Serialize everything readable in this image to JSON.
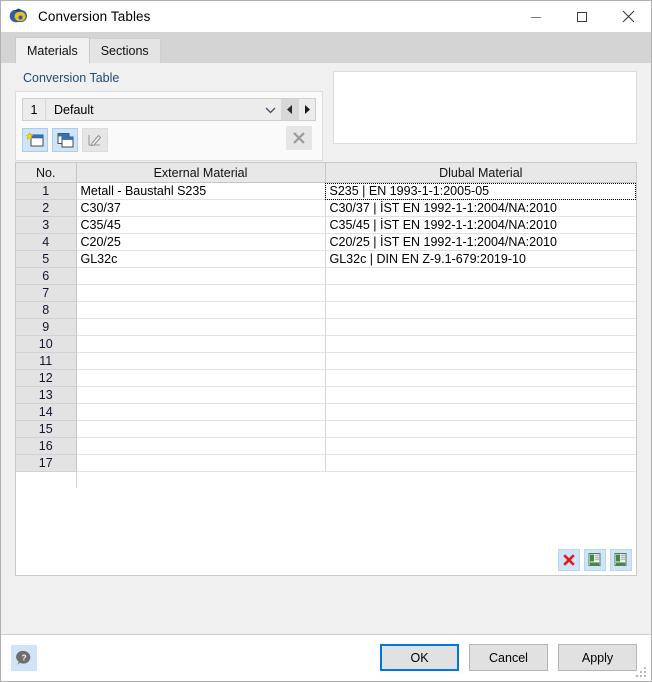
{
  "window": {
    "title": "Conversion Tables",
    "icon": "rfem-logo-icon",
    "minimize_label": "–",
    "maximize_label": "□",
    "close_label": "✕"
  },
  "tabs": [
    {
      "label": "Materials",
      "active": true
    },
    {
      "label": "Sections",
      "active": false
    }
  ],
  "conversion_table": {
    "group_title": "Conversion Table",
    "number": "1",
    "selected": "Default",
    "options": [
      "Default"
    ],
    "chevron": "∨",
    "prev_arrow": "◄",
    "next_arrow": "►",
    "buttons": [
      {
        "name": "new-table-button",
        "title": "New",
        "enabled": true
      },
      {
        "name": "copy-table-button",
        "title": "Copy",
        "enabled": true
      },
      {
        "name": "rename-table-button",
        "title": "Rename",
        "enabled": false
      }
    ],
    "delete_button": {
      "name": "delete-table-button",
      "glyph": "✕",
      "enabled": false
    }
  },
  "table": {
    "columns": [
      "No.",
      "External Material",
      "Dlubal Material"
    ],
    "rows": [
      {
        "no": "1",
        "external": "Metall - Baustahl S235",
        "dlubal": "S235 | EN 1993-1-1:2005-05",
        "focused": true
      },
      {
        "no": "2",
        "external": "C30/37",
        "dlubal": "C30/37 | İST EN 1992-1-1:2004/NA:2010",
        "focused": false
      },
      {
        "no": "3",
        "external": "C35/45",
        "dlubal": "C35/45 | İST EN 1992-1-1:2004/NA:2010",
        "focused": false
      },
      {
        "no": "4",
        "external": "C20/25",
        "dlubal": "C20/25 | İST EN 1992-1-1:2004/NA:2010",
        "focused": false
      },
      {
        "no": "5",
        "external": "GL32c",
        "dlubal": "GL32c | DIN EN Z-9.1-679:2019-10",
        "focused": false
      },
      {
        "no": "6",
        "external": "",
        "dlubal": "",
        "focused": false
      },
      {
        "no": "7",
        "external": "",
        "dlubal": "",
        "focused": false
      },
      {
        "no": "8",
        "external": "",
        "dlubal": "",
        "focused": false
      },
      {
        "no": "9",
        "external": "",
        "dlubal": "",
        "focused": false
      },
      {
        "no": "10",
        "external": "",
        "dlubal": "",
        "focused": false
      },
      {
        "no": "11",
        "external": "",
        "dlubal": "",
        "focused": false
      },
      {
        "no": "12",
        "external": "",
        "dlubal": "",
        "focused": false
      },
      {
        "no": "13",
        "external": "",
        "dlubal": "",
        "focused": false
      },
      {
        "no": "14",
        "external": "",
        "dlubal": "",
        "focused": false
      },
      {
        "no": "15",
        "external": "",
        "dlubal": "",
        "focused": false
      },
      {
        "no": "16",
        "external": "",
        "dlubal": "",
        "focused": false
      },
      {
        "no": "17",
        "external": "",
        "dlubal": "",
        "focused": false
      }
    ],
    "tools": [
      {
        "name": "delete-row-button",
        "icon": "red-x-icon"
      },
      {
        "name": "import-excel-button",
        "icon": "excel-import-icon"
      },
      {
        "name": "export-excel-button",
        "icon": "excel-export-icon"
      }
    ]
  },
  "footer": {
    "help": {
      "name": "help-button",
      "glyph": "?"
    },
    "buttons": [
      {
        "label": "OK",
        "name": "ok-button",
        "default": true
      },
      {
        "label": "Cancel",
        "name": "cancel-button",
        "default": false
      },
      {
        "label": "Apply",
        "name": "apply-button",
        "default": false
      }
    ]
  },
  "colors": {
    "accent": "#0078d7",
    "group_title": "#1f4e79",
    "toolbtn_bg": "#cfe4f7",
    "header_bg": "#e8e8e8",
    "rownum_bg": "#e3e3e3",
    "delete_red": "#e01b1b"
  }
}
